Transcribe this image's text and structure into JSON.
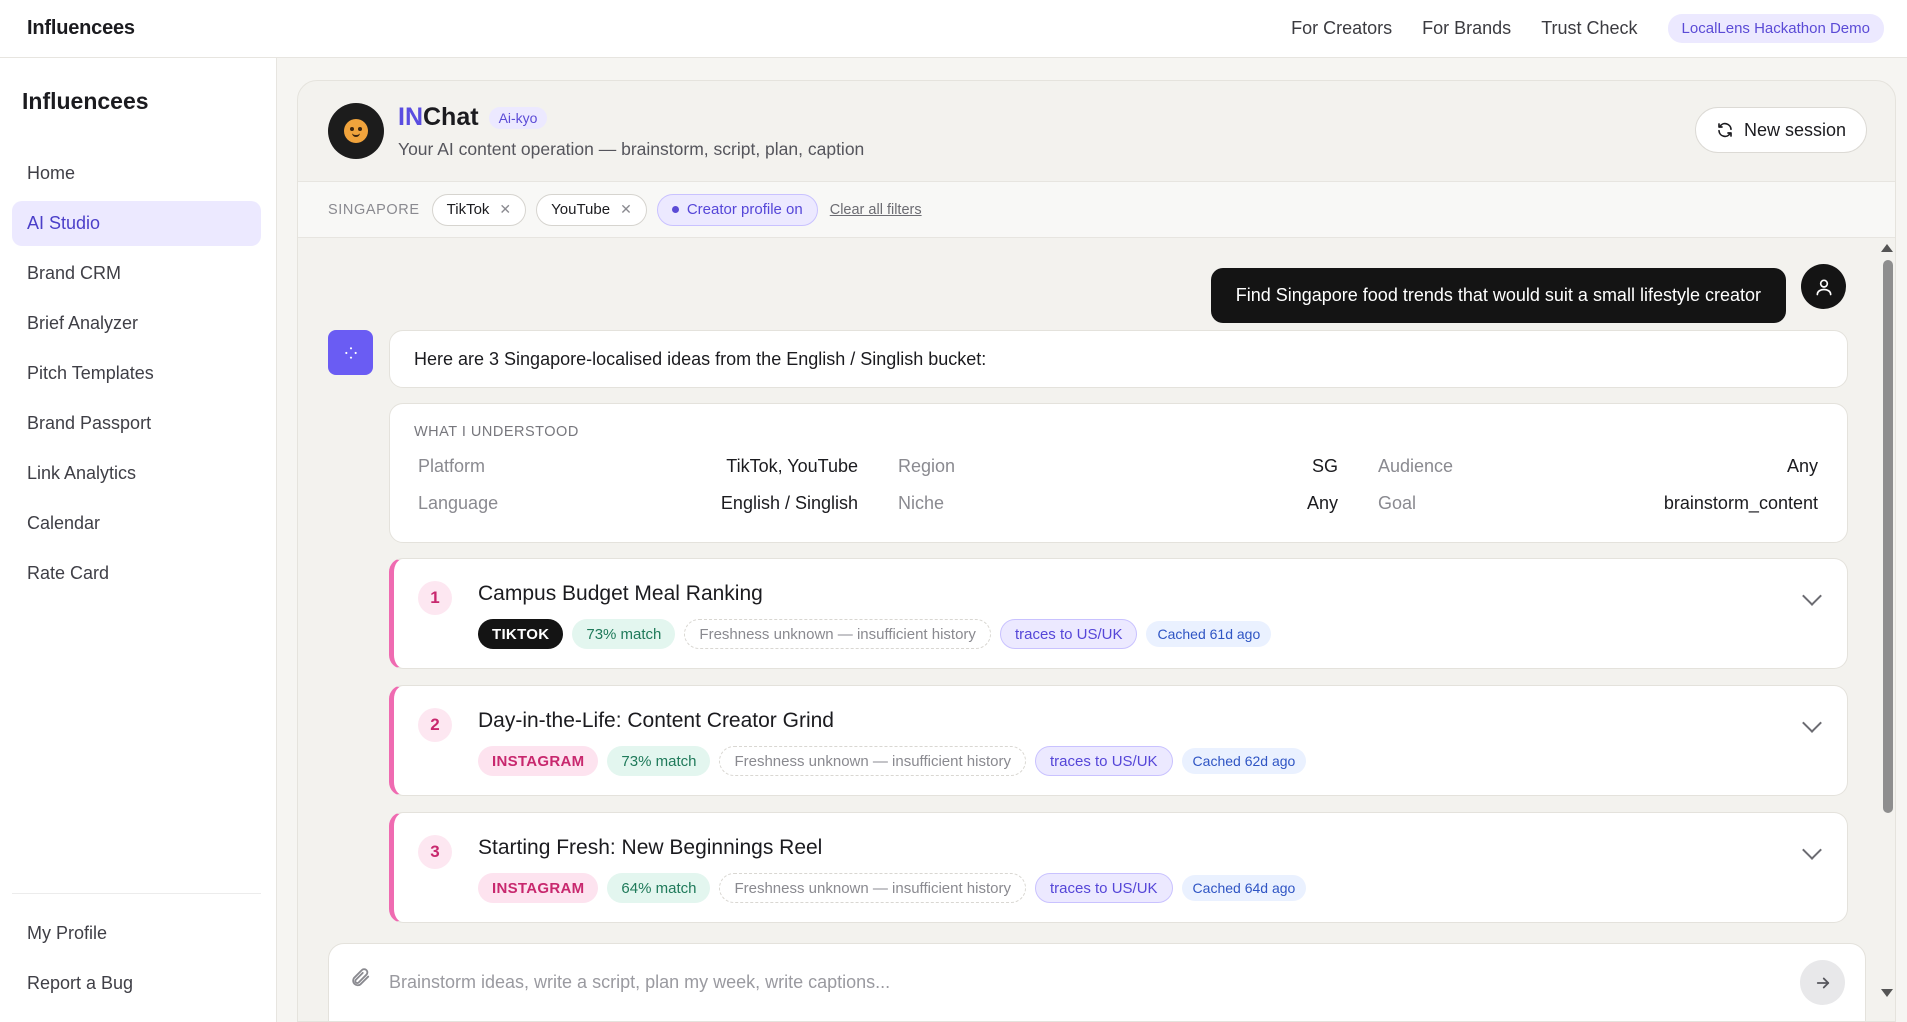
{
  "topbar": {
    "brand": "Influencees",
    "nav": [
      "For Creators",
      "For Brands",
      "Trust Check"
    ],
    "demo_pill": "LocalLens Hackathon Demo"
  },
  "sidebar": {
    "brand": "Influencees",
    "items": [
      {
        "label": "Home",
        "icon": "home-icon"
      },
      {
        "label": "AI Studio",
        "active": true
      },
      {
        "label": "Brand CRM"
      },
      {
        "label": "Brief Analyzer"
      },
      {
        "label": "Pitch Templates"
      },
      {
        "label": "Brand Passport"
      },
      {
        "label": "Link Analytics"
      },
      {
        "label": "Calendar"
      },
      {
        "label": "Rate Card"
      }
    ],
    "bottom": [
      {
        "label": "My Profile"
      },
      {
        "label": "Report a Bug"
      }
    ]
  },
  "chat": {
    "title_accent": "IN",
    "title_rest": "Chat",
    "badge": "Ai-kyo",
    "subtitle": "Your AI content operation — brainstorm, script, plan, caption",
    "new_session": "New session"
  },
  "filters": {
    "region": "SINGAPORE",
    "chips": [
      "TikTok",
      "YouTube"
    ],
    "profile_chip": "Creator profile on",
    "clear": "Clear all filters"
  },
  "messages": {
    "user": "Find Singapore food trends that would suit a small lifestyle creator",
    "ai_intro": "Here are 3 Singapore-localised ideas from the English / Singlish bucket:"
  },
  "understood": {
    "title": "WHAT I UNDERSTOOD",
    "rows": [
      [
        {
          "k": "Platform",
          "v": "TikTok, YouTube"
        },
        {
          "k": "Region",
          "v": "SG"
        },
        {
          "k": "Audience",
          "v": "Any"
        }
      ],
      [
        {
          "k": "Language",
          "v": "English / Singlish"
        },
        {
          "k": "Niche",
          "v": "Any"
        },
        {
          "k": "Goal",
          "v": "brainstorm_content"
        }
      ]
    ]
  },
  "ideas": [
    {
      "num": "1",
      "title": "Campus Budget Meal Ranking",
      "platform": "TIKTOK",
      "match": "73% match",
      "freshness": "Freshness unknown — insufficient history",
      "trace": "traces to US/UK",
      "cache": "Cached 61d ago"
    },
    {
      "num": "2",
      "title": "Day-in-the-Life: Content Creator Grind",
      "platform": "INSTAGRAM",
      "match": "73% match",
      "freshness": "Freshness unknown — insufficient history",
      "trace": "traces to US/UK",
      "cache": "Cached 62d ago"
    },
    {
      "num": "3",
      "title": "Starting Fresh: New Beginnings Reel",
      "platform": "INSTAGRAM",
      "match": "64% match",
      "freshness": "Freshness unknown — insufficient history",
      "trace": "traces to US/UK",
      "cache": "Cached 64d ago"
    }
  ],
  "composer": {
    "placeholder": "Brainstorm ideas, write a script, plan my week, write captions..."
  },
  "colors": {
    "accent": "#5b4bd6",
    "ai_avatar": "#6a5cf3",
    "idea_border": "#ef6bb1",
    "tiktok_tag": "#141414",
    "instagram_tag": "#c8286e",
    "match_tag": "#1f7a5a"
  }
}
